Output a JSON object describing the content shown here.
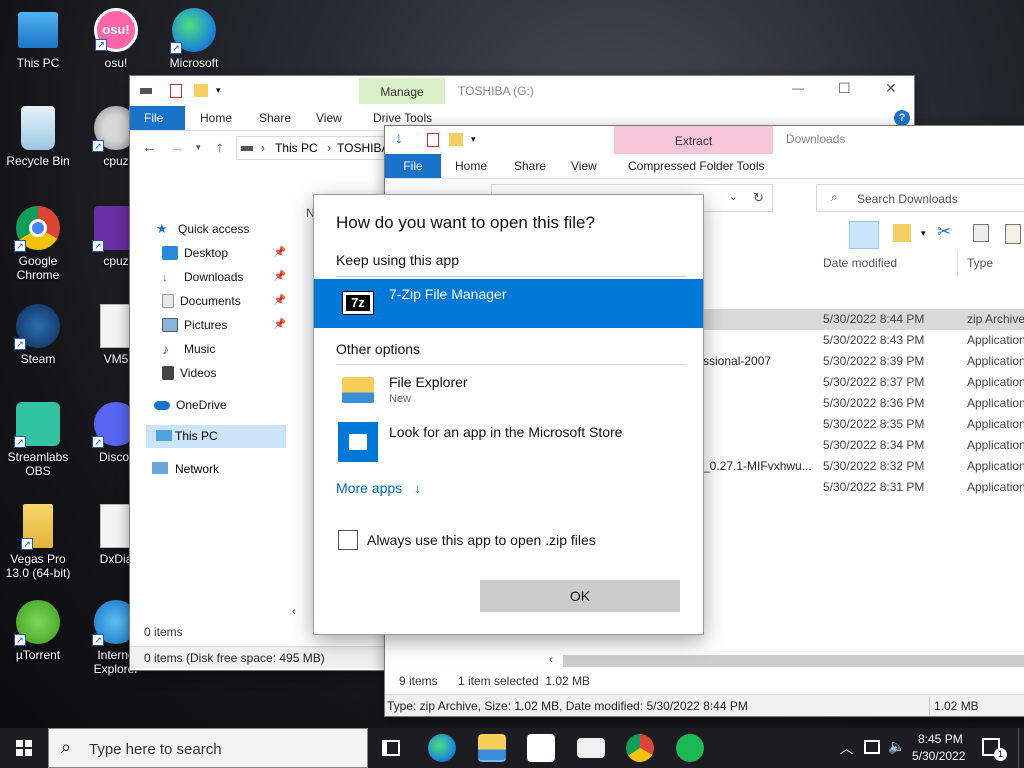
{
  "desktop": {
    "icons": [
      {
        "label": "This PC"
      },
      {
        "label": "osu!"
      },
      {
        "label": "Microsoft"
      },
      {
        "label": "Recycle Bin"
      },
      {
        "label": "cpuz"
      },
      {
        "label": "Google Chrome"
      },
      {
        "label": "cpuz"
      },
      {
        "label": "Steam"
      },
      {
        "label": "VM5"
      },
      {
        "label": "Streamlabs OBS"
      },
      {
        "label": "Discor"
      },
      {
        "label": "Vegas Pro 13.0 (64-bit)"
      },
      {
        "label": "DxDia"
      },
      {
        "label": "µTorrent"
      },
      {
        "label": "Interne Explorer"
      }
    ],
    "osu_badge": "osu!"
  },
  "win1": {
    "title": "TOSHIBA (G:)",
    "context_tab": "Manage",
    "context_sub": "Drive Tools",
    "tabs": [
      "File",
      "Home",
      "Share",
      "View"
    ],
    "path": [
      "This PC",
      "TOSHIBA"
    ],
    "sidebar": [
      {
        "label": "Quick access"
      },
      {
        "label": "Desktop"
      },
      {
        "label": "Downloads"
      },
      {
        "label": "Documents"
      },
      {
        "label": "Pictures"
      },
      {
        "label": "Music"
      },
      {
        "label": "Videos"
      },
      {
        "label": "OneDrive"
      },
      {
        "label": "This PC"
      },
      {
        "label": "Network"
      }
    ],
    "header_char": "N",
    "items_count": "0 items",
    "status": "0 items (Disk free space: 495 MB)",
    "window_controls": [
      "—",
      "☐",
      "✕"
    ],
    "help": "?"
  },
  "win2": {
    "title": "Downloads",
    "context_tab": "Extract",
    "context_sub": "Compressed Folder Tools",
    "tabs": [
      "File",
      "Home",
      "Share",
      "View"
    ],
    "search_placeholder": "Search Downloads",
    "col_date": "Date modified",
    "col_type": "Type",
    "rows": [
      {
        "name": "",
        "date": "5/30/2022 8:44 PM",
        "type": "zip Archive"
      },
      {
        "name": "",
        "date": "5/30/2022 8:43 PM",
        "type": "Application"
      },
      {
        "name": "ssional-2007",
        "date": "5/30/2022 8:39 PM",
        "type": "Application"
      },
      {
        "name": "",
        "date": "5/30/2022 8:37 PM",
        "type": "Application"
      },
      {
        "name": "",
        "date": "5/30/2022 8:36 PM",
        "type": "Application"
      },
      {
        "name": "",
        "date": "5/30/2022 8:35 PM",
        "type": "Application"
      },
      {
        "name": "",
        "date": "5/30/2022 8:34 PM",
        "type": "Application"
      },
      {
        "name": "_0.27.1-MIFvxhwu...",
        "date": "5/30/2022 8:32 PM",
        "type": "Application"
      },
      {
        "name": "",
        "date": "5/30/2022 8:31 PM",
        "type": "Application"
      }
    ],
    "status_items": "9 items",
    "status_selected": "1 item selected  1.02 MB",
    "details": "Type: zip Archive, Size: 1.02 MB, Date modified: 5/30/2022 8:44 PM",
    "details_size": "1.02 MB"
  },
  "dialog": {
    "title": "How do you want to open this file?",
    "keep_using": "Keep using this app",
    "current_app": "7-Zip File Manager",
    "current_app_icon": "7z",
    "other_options": "Other options",
    "options": [
      {
        "name": "File Explorer",
        "sub": "New"
      },
      {
        "name": "Look for an app in the Microsoft Store",
        "sub": ""
      }
    ],
    "more_apps": "More apps",
    "more_apps_arrow": "↓",
    "always_use": "Always use this app to open .zip files",
    "ok": "OK"
  },
  "taskbar": {
    "search_placeholder": "Type here to search",
    "time": "8:45 PM",
    "date": "5/30/2022",
    "notification_count": "1"
  },
  "colors": {
    "accent": "#0078d7",
    "file_tab": "#1a73c9",
    "manage_tab": "#d9f0c6",
    "extract_tab": "#f7c7d9",
    "selected_row": "#0078d7"
  }
}
